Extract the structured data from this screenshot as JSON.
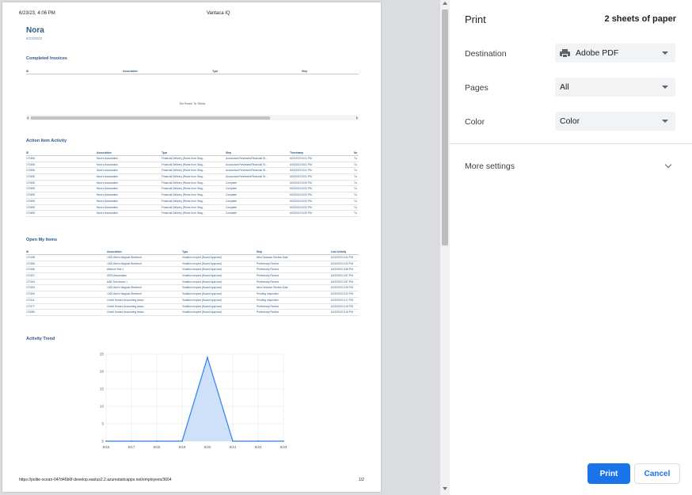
{
  "page_header": {
    "datetime": "6/23/23, 4:06 PM",
    "app_title": "Vantaca IQ"
  },
  "report": {
    "name": "Nora",
    "date": "6/23/2023"
  },
  "completed_invoices": {
    "title": "Completed Invoices",
    "columns": [
      "ID",
      "Association",
      "Type",
      "Step"
    ],
    "empty_text": "No Rows To Show"
  },
  "action_item_activity": {
    "title": "Action Item Activity",
    "columns": [
      "ID",
      "Association",
      "Type",
      "Step",
      "Timestamp",
      "Ne"
    ],
    "rows": [
      [
        "170496",
        "Nora's Association",
        "Financial Delivery (Rules from Stag...",
        "Accountant Reviewed/Financial St...",
        "6/20/2023 5:01 PM",
        "Tu"
      ],
      [
        "170496",
        "Nora's Association",
        "Financial Delivery (Rules from Stag...",
        "Accountant Reviewed/Financial St...",
        "6/20/2023 5:01 PM",
        "Tu"
      ],
      [
        "170496",
        "Nora's Association",
        "Financial Delivery (Rules from Stag...",
        "Accountant Reviewed/Financial St...",
        "6/20/2023 5:01 PM",
        "Tu"
      ],
      [
        "170496",
        "Nora's Association",
        "Financial Delivery (Rules from Stag...",
        "Accountant Reviewed/Financial St...",
        "6/20/2023 5:01 PM",
        "Tu"
      ],
      [
        "170496",
        "Nora's Association",
        "Financial Delivery (Rules from Stag...",
        "Complete",
        "6/20/2023 5:00 PM",
        "Tu"
      ],
      [
        "170495",
        "Nora's Association",
        "Financial Delivery (Rules from Stag...",
        "Complete",
        "6/20/2023 5:00 PM",
        "Tu"
      ],
      [
        "170495",
        "Nora's Association",
        "Financial Delivery (Rules from Stag...",
        "Complete",
        "6/20/2023 5:00 PM",
        "Tu"
      ],
      [
        "170495",
        "Nora's Association",
        "Financial Delivery (Rules from Stag...",
        "Complete",
        "6/20/2023 5:00 PM",
        "Tu"
      ],
      [
        "170495",
        "Nora's Association",
        "Financial Delivery (Rules from Stag...",
        "Complete",
        "6/20/2023 5:00 PM",
        "Tu"
      ],
      [
        "170495",
        "Nora's Association",
        "Financial Delivery (Rules from Stag...",
        "Complete",
        "6/20/2023 5:00 PM",
        "Tu"
      ]
    ]
  },
  "open_my_items": {
    "title": "Open My Items",
    "columns": [
      "ID",
      "Association",
      "Type",
      "Step",
      "Last Activity"
    ],
    "rows": [
      [
        "170158",
        "1000 Alex's Magical Weekend",
        "Violation Inspect (Board Approval)",
        "New Decision Review Date",
        "6/22/2023 4:04 PM"
      ],
      [
        "170165",
        "1000 Alex's Magical Weekend",
        "Violation Inspect (Board Approval)",
        "Preliminary Review",
        "6/22/2023 4:03 PM"
      ],
      [
        "170156",
        "Alliance Test 1",
        "Violation Inspect (Board Approval)",
        "Preliminary Review",
        "6/22/2023 3:58 PM"
      ],
      [
        "170157",
        "ZERI Association",
        "Violation Inspect (Board Approval)",
        "Preliminary Review",
        "6/22/2023 3:57 PM"
      ],
      [
        "170154",
        "AAB Test Assoc 1",
        "Violation Inspect (Board Approval)",
        "Preliminary Review",
        "6/22/2023 3:57 PM"
      ],
      [
        "170153",
        "1000 Alex's Magical Weekend",
        "Violation Inspect (Board Approval)",
        "New Decision Review Date",
        "6/22/2023 3:49 PM"
      ],
      [
        "170150",
        "1000 Alex's Magical Weekend",
        "Violation Inspect (Board Approval)",
        "Pending Inspection",
        "6/22/2023 3:22 PM"
      ],
      [
        "170111",
        "Credit Homes Accounting Assoc",
        "Violation Inspect (Board Approval)",
        "Pending Inspection",
        "6/22/2023 3:17 PM"
      ],
      [
        "170177",
        "Credit Homes Accounting Assoc",
        "Violation Inspect (Board Approval)",
        "Preliminary Review",
        "6/22/2023 3:15 PM"
      ],
      [
        "170080",
        "Credit Homes Accounting Assoc",
        "Violation Inspect (Board Approval)",
        "Preliminary Review",
        "6/22/2023 3:15 PM"
      ]
    ]
  },
  "activity_trend": {
    "title": "Activity Trend"
  },
  "chart_data": {
    "type": "area",
    "title": "Activity Trend",
    "categories": [
      "6/16",
      "6/17",
      "6/18",
      "6/19",
      "6/20",
      "6/21",
      "6/22",
      "6/23"
    ],
    "values": [
      0,
      0,
      0,
      0,
      24,
      0,
      0,
      0
    ],
    "ylim": [
      0,
      25
    ],
    "yticks": [
      0,
      5,
      10,
      15,
      20,
      25
    ],
    "grid": true,
    "line_color": "#2f80ed",
    "fill_color": "#c6dcf7"
  },
  "page_footer": {
    "url": "https://polite-ocean-047d46b0f-develop.eastus2.2.azurestaticapps.net/employees/3654",
    "page": "1/2"
  },
  "print_panel": {
    "title": "Print",
    "sheets": "2 sheets of paper",
    "destination_label": "Destination",
    "destination_value": "Adobe PDF",
    "pages_label": "Pages",
    "pages_value": "All",
    "color_label": "Color",
    "color_value": "Color",
    "more_settings": "More settings",
    "print_button": "Print",
    "cancel_button": "Cancel",
    "accent": "#1a73e8"
  }
}
